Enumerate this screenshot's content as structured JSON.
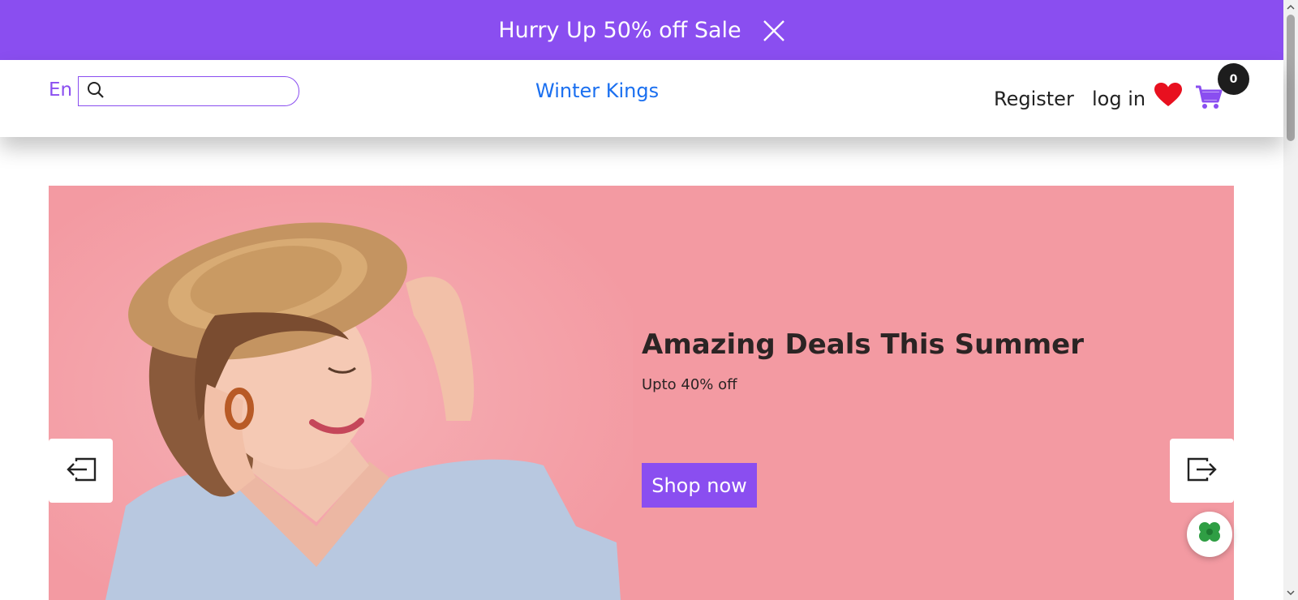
{
  "promo": {
    "text": "Hurry Up 50% off Sale",
    "close_icon": "close-icon"
  },
  "navbar": {
    "language": "En",
    "search_placeholder": "",
    "search_icon": "search-icon",
    "brand": "Winter Kings",
    "register": "Register",
    "login": "log in",
    "wishlist_icon": "heart-icon",
    "cart_icon": "cart-icon",
    "cart_count": "0"
  },
  "hero": {
    "title": "Amazing Deals This Summer",
    "subtitle": "Upto 40% off",
    "cta": "Shop now",
    "prev_icon": "sign-in-arrow-icon",
    "next_icon": "sign-out-arrow-icon"
  },
  "colors": {
    "accent": "#8a4ef0",
    "brand_link": "#1a6ff0",
    "hero_bg": "#f39aa2",
    "heart": "#e8101f"
  }
}
